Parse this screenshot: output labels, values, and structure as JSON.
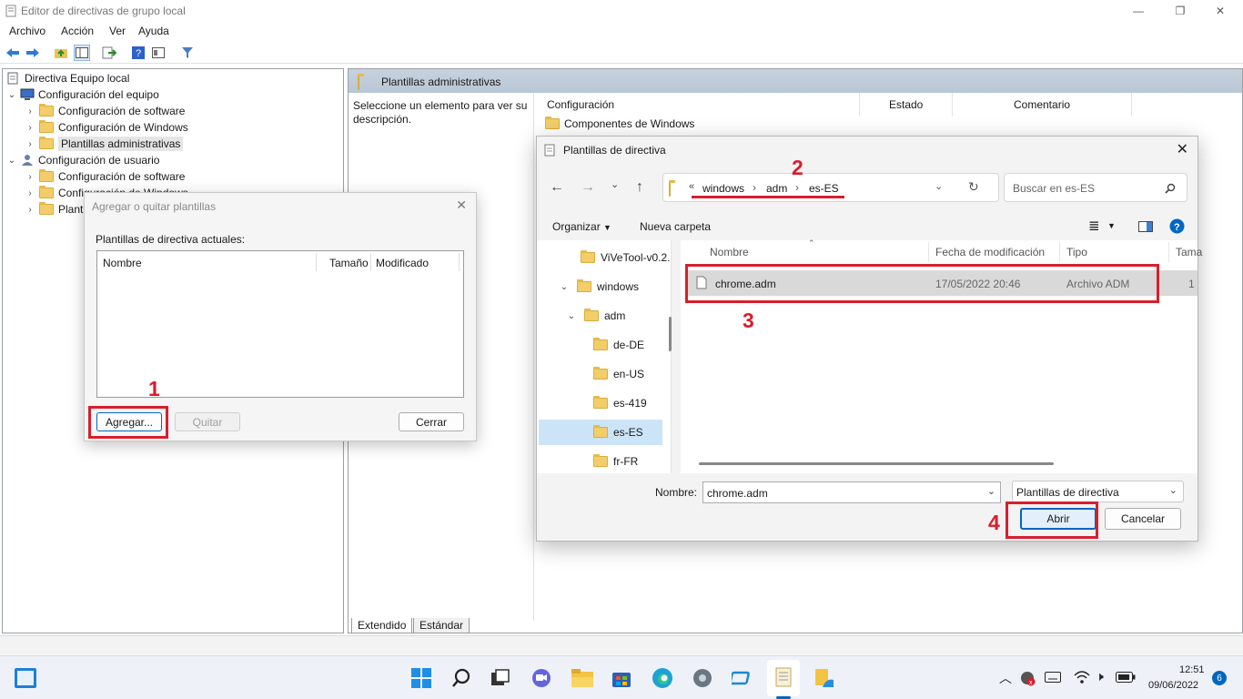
{
  "window": {
    "title": "Editor de directivas de grupo local"
  },
  "menu": [
    "Archivo",
    "Acción",
    "Ver",
    "Ayuda"
  ],
  "tree": {
    "root": "Directiva Equipo local",
    "computer": "Configuración del equipo",
    "software": "Configuración de software",
    "windows_cfg": "Configuración de Windows",
    "admin_templates": "Plantillas administrativas",
    "user": "Configuración de usuario",
    "user_software": "Configuración de software",
    "user_windows": "Configuración de Windows",
    "user_admin": "Plantillas administrativas"
  },
  "right_pane": {
    "header": "Plantillas administrativas",
    "description": "Seleccione un elemento para ver su descripción.",
    "columns": [
      "Configuración",
      "Estado",
      "Comentario"
    ],
    "rows": [
      "Componentes de Windows"
    ],
    "tabs": [
      "Extendido",
      "Estándar"
    ]
  },
  "add_remove_dialog": {
    "title": "Agregar o quitar plantillas",
    "label": "Plantillas de directiva actuales:",
    "columns": [
      "Nombre",
      "Tamaño",
      "Modificado"
    ],
    "add_button": "Agregar...",
    "remove_button": "Quitar",
    "close_button": "Cerrar"
  },
  "open_dialog": {
    "title": "Plantillas de directiva",
    "breadcrumb_prefix": "«",
    "breadcrumb": [
      "windows",
      "adm",
      "es-ES"
    ],
    "search_placeholder": "Buscar en es-ES",
    "organize": "Organizar",
    "new_folder": "Nueva carpeta",
    "nav_items": [
      "ViVeTool-v0.2.",
      "windows",
      "adm",
      "de-DE",
      "en-US",
      "es-419",
      "es-ES",
      "fr-FR"
    ],
    "file_columns": [
      "Nombre",
      "Fecha de modificación",
      "Tipo",
      "Tama"
    ],
    "file": {
      "name": "chrome.adm",
      "modified": "17/05/2022 20:46",
      "type": "Archivo ADM",
      "size": "1"
    },
    "name_label": "Nombre:",
    "name_value": "chrome.adm",
    "filter_value": "Plantillas de directiva",
    "open_button": "Abrir",
    "cancel_button": "Cancelar"
  },
  "annotations": [
    "1",
    "2",
    "3",
    "4"
  ],
  "taskbar": {
    "time": "12:51",
    "date": "09/06/2022",
    "notifications": "6"
  },
  "colors": {
    "annotation_red": "#d81e2c",
    "folder_yellow": "#f2cd6a",
    "accent_blue": "#0067c0"
  }
}
